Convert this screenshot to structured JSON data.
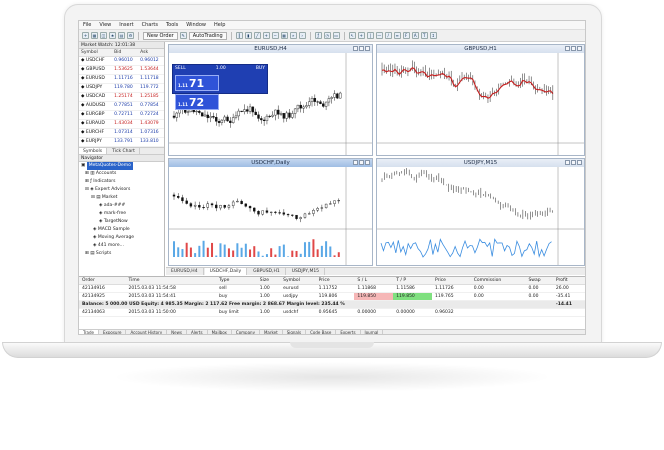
{
  "menu": [
    "File",
    "View",
    "Insert",
    "Charts",
    "Tools",
    "Window",
    "Help"
  ],
  "toolbar": {
    "new_order": "New Order",
    "autotrading": "AutoTrading"
  },
  "market_watch": {
    "title": "Market Watch: 12:01:38",
    "headers": [
      "Symbol",
      "Bid",
      "Ask"
    ],
    "rows": [
      {
        "symbol": "USDCHF",
        "bid": "0.96010",
        "ask": "0.96012"
      },
      {
        "symbol": "GBPUSD",
        "bid": "1.53625",
        "ask": "1.53644"
      },
      {
        "symbol": "EURUSD",
        "bid": "1.11716",
        "ask": "1.11718"
      },
      {
        "symbol": "USDJPY",
        "bid": "119.780",
        "ask": "119.772"
      },
      {
        "symbol": "USDCAD",
        "bid": "1.25174",
        "ask": "1.25185"
      },
      {
        "symbol": "AUDUSD",
        "bid": "0.77851",
        "ask": "0.77854"
      },
      {
        "symbol": "EURGBP",
        "bid": "0.72711",
        "ask": "0.72724"
      },
      {
        "symbol": "EURAUD",
        "bid": "1.43034",
        "ask": "1.43079"
      },
      {
        "symbol": "EURCHF",
        "bid": "1.07314",
        "ask": "1.07316"
      },
      {
        "symbol": "EURJPY",
        "bid": "133.791",
        "ask": "133.810"
      }
    ],
    "tabs": [
      "Symbols",
      "Tick Chart"
    ]
  },
  "navigator": {
    "title": "Navigator",
    "items": [
      "MetaQuotes-Demo",
      "Accounts",
      "Indicators",
      "Expert Advisors",
      "Market",
      "ada-###",
      "mark-free",
      "TargetNow",
      "MACD Sample",
      "Moving Average",
      "441 more...",
      "Scripts"
    ],
    "tabs": [
      "Common",
      "Favorites"
    ]
  },
  "charts": [
    {
      "title": "EURUSD,H4",
      "buy": "72",
      "sell": "71",
      "lot": "1.00",
      "ticker_label": "EURUSD,H4 1.11718 1.11738 1.11678 1.11712"
    },
    {
      "title": "GBPUSD,H1"
    },
    {
      "title": "USDCHF,Daily",
      "indicator": "Stochastic (5,3,3)"
    },
    {
      "title": "USDJPY,M15"
    }
  ],
  "chart_tabs": [
    "EURUSD,H4",
    "USDCHF,Daily",
    "GBPUSD,H1",
    "USDJPY,M15"
  ],
  "terminal": {
    "headers": [
      "Order",
      "Time",
      "Type",
      "Size",
      "Symbol",
      "Price",
      "S / L",
      "T / P",
      "Price",
      "Commission",
      "Swap",
      "Profit"
    ],
    "rows": [
      [
        "42134916",
        "2015.03.03 11:54:58",
        "sell",
        "1.00",
        "eurusd",
        "1.11752",
        "1.11868",
        "1.11586",
        "1.11726",
        "0.00",
        "0.00",
        "26.00"
      ],
      [
        "42134925",
        "2015.03.03 11:54:41",
        "buy",
        "1.00",
        "usdjpy",
        "119.806",
        "119.850",
        "119.850",
        "119.765",
        "0.00",
        "0.00",
        "-35.41"
      ]
    ],
    "balance": "Balance: 5 000.00 USD   Equity: 4 985.35   Margin: 2 117.62   Free margin: 2 868.67   Margin level: 235.44 %",
    "balance_profit": "-14.41",
    "pending": [
      "42134063",
      "2015.03.03 11:50:00",
      "buy limit",
      "1.00",
      "usdchf",
      "0.95645",
      "0.00000",
      "0.00000",
      "0.96032",
      "",
      "",
      ""
    ],
    "tabs": [
      "Trade",
      "Exposure",
      "Account History",
      "News",
      "Alerts",
      "Mailbox",
      "Company",
      "Market",
      "Signals",
      "Code Base",
      "Experts",
      "Journal"
    ]
  }
}
